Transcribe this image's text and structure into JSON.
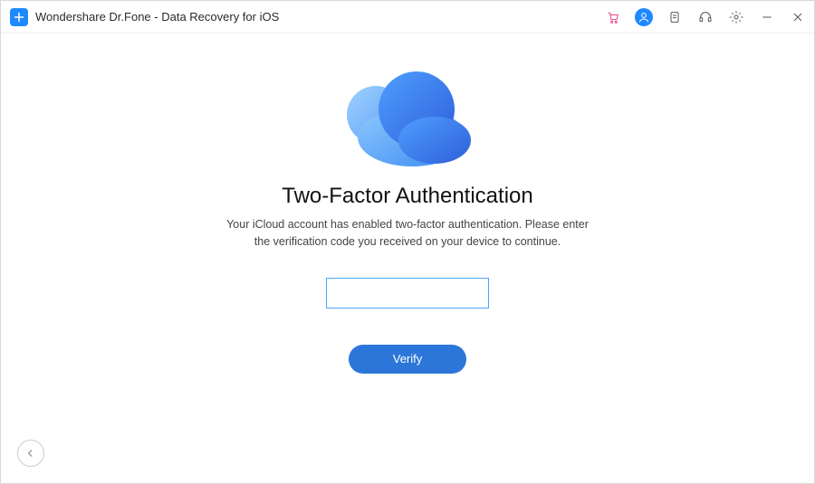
{
  "window": {
    "title": "Wondershare Dr.Fone - Data Recovery for iOS"
  },
  "titlebar_icons": {
    "cart": "cart-icon",
    "account": "account-icon",
    "feedback": "clipboard-icon",
    "support": "headset-icon",
    "settings": "gear-icon",
    "minimize": "minimize-icon",
    "close": "close-icon"
  },
  "main": {
    "heading": "Two-Factor Authentication",
    "subtext": "Your iCloud account has enabled two-factor authentication. Please enter the verification code you received on your device to continue.",
    "code_value": "",
    "verify_label": "Verify"
  },
  "nav": {
    "back": "back"
  },
  "colors": {
    "accent": "#2d76d9",
    "input_border": "#4da3ff",
    "cart_icon": "#e8408a"
  }
}
